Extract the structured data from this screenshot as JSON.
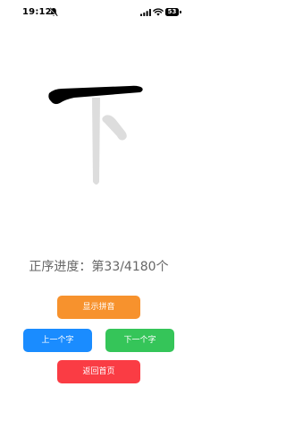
{
  "status_bar": {
    "time": "19:12",
    "battery_level": "53",
    "icons": [
      "bell-slash-icon",
      "cellular-signal-icon",
      "wifi-icon",
      "battery-icon"
    ]
  },
  "character": {
    "glyph": "下",
    "stroke_color_active": "#000000",
    "stroke_color_inactive": "#dddddd"
  },
  "progress": {
    "text": "正序进度：第33/4180个"
  },
  "buttons": {
    "show_pinyin": "显示拼音",
    "prev_char": "上一个字",
    "next_char": "下一个字",
    "back_home": "返回首页"
  },
  "colors": {
    "pinyin_button": "#f7922d",
    "prev_button": "#1a8cff",
    "next_button": "#35c559",
    "home_button": "#fa3c44"
  }
}
